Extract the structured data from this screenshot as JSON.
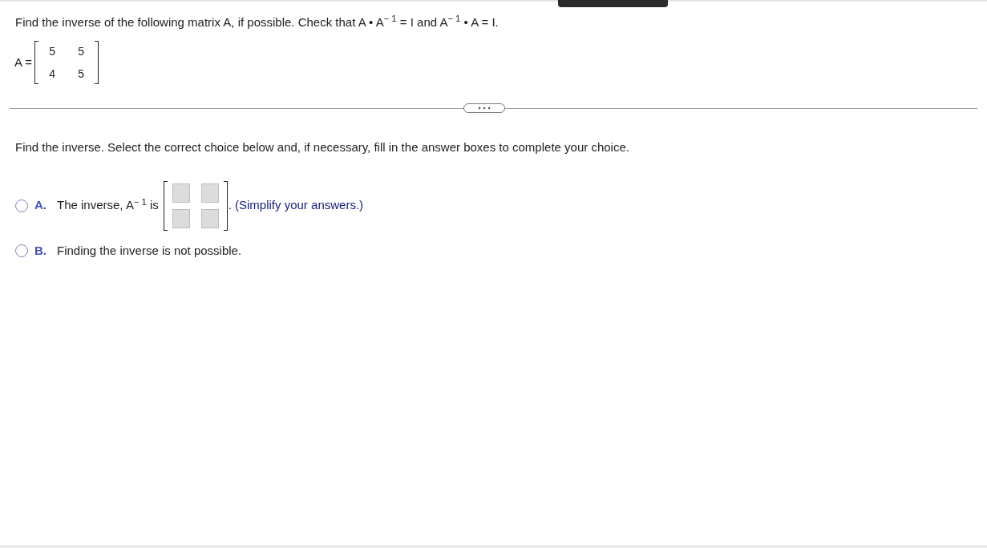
{
  "question": {
    "text": "Find the inverse of the following matrix A, if possible. Check that A • A$^{− 1}$ = I and A$^{− 1}$ • A = I.",
    "matrix_label": "A =",
    "matrix": [
      [
        "5",
        "5"
      ],
      [
        "4",
        "5"
      ]
    ]
  },
  "instruction": "Find the inverse. Select the correct choice below and, if necessary, fill in the answer boxes to complete your choice.",
  "choices": [
    {
      "kind": "matrix",
      "letter": "A.",
      "selected": false,
      "text": "The inverse, A$^{− 1}$ is",
      "boxes": [
        [
          {
            "kind": "input"
          },
          {
            "kind": "input"
          }
        ],
        [
          {
            "kind": "input"
          },
          {
            "kind": "input"
          }
        ]
      ],
      "after": ".",
      "hint": "(Simplify your answers.)"
    },
    {
      "kind": "text",
      "letter": "B.",
      "selected": false,
      "text": "Finding the inverse is not possible."
    }
  ]
}
